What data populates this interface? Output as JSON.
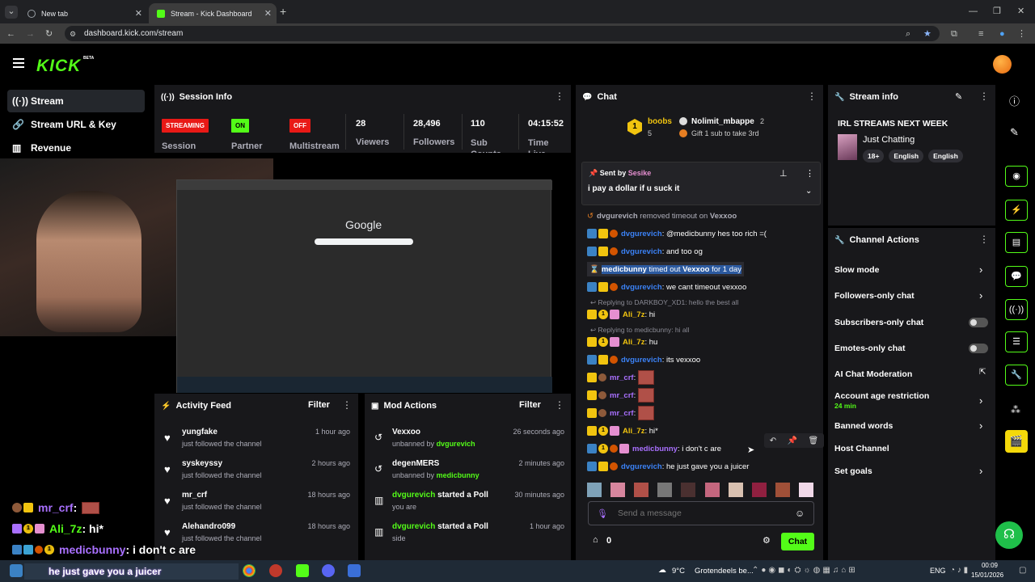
{
  "browser": {
    "tabs": [
      {
        "label": "New tab"
      },
      {
        "label": "Stream - Kick Dashboard"
      }
    ],
    "url": "dashboard.kick.com/stream"
  },
  "brand": {
    "logo": "KICK",
    "beta": "BETA"
  },
  "nav": [
    {
      "label": "Stream",
      "icon": "stream-icon"
    },
    {
      "label": "Stream URL & Key",
      "icon": "link-icon"
    },
    {
      "label": "Revenue",
      "icon": "revenue-icon"
    }
  ],
  "session": {
    "title": "Session Info",
    "streaming": "STREAMING",
    "partner_badge": "ON",
    "multistream_badge": "OFF",
    "session_label": "Session",
    "partner_label": "Partner",
    "multistream_label": "Multistream",
    "stats": [
      {
        "value": "28",
        "label": "Viewers"
      },
      {
        "value": "28,496",
        "label": "Followers"
      },
      {
        "value": "110",
        "label": "Sub Counts"
      },
      {
        "value": "04:15:52",
        "label": "Time Live"
      }
    ]
  },
  "preview": {
    "search_engine": "Google"
  },
  "activity": {
    "title": "Activity Feed",
    "filter": "Filter",
    "items": [
      {
        "name": "yungfake",
        "sub": "just followed the channel",
        "time": "1 hour ago"
      },
      {
        "name": "syskeyssy",
        "sub": "just followed the channel",
        "time": "2 hours ago"
      },
      {
        "name": "mr_crf",
        "sub": "just followed the channel",
        "time": "18 hours ago"
      },
      {
        "name": "Alehandro099",
        "sub": "just followed the channel",
        "time": "18 hours ago"
      }
    ]
  },
  "mod": {
    "title": "Mod Actions",
    "filter": "Filter",
    "items": [
      {
        "name": "Vexxoo",
        "sub_prefix": "unbanned by ",
        "sub_user": "dvgurevich",
        "time": "26 seconds ago",
        "icon": "undo-icon"
      },
      {
        "name": "degenMERS",
        "sub_prefix": "unbanned by ",
        "sub_user": "medicbunny",
        "time": "2 minutes ago",
        "icon": "undo-icon"
      },
      {
        "name": "dvgurevich",
        "name_suffix": " started a Poll",
        "sub_prefix": "you are",
        "sub_user": "",
        "time": "30 minutes ago",
        "icon": "poll-icon"
      },
      {
        "name": "dvgurevich",
        "name_suffix": " started a Poll",
        "sub_prefix": "side",
        "sub_user": "",
        "time": "1 hour ago",
        "icon": "poll-icon"
      }
    ]
  },
  "chat": {
    "title": "Chat",
    "leaderboard": {
      "rank": "1",
      "name1": "boobs",
      "count1": "5",
      "name2": "Nolimit_mbappe",
      "count2": "2",
      "gift": "Gift 1 sub to take 3rd"
    },
    "pinned": {
      "sent_by_label": "Sent by",
      "sent_by": "Sesike",
      "message": "i pay a dollar if u suck it"
    },
    "system": {
      "user": "dvgurevich",
      "text": "removed timeout on",
      "target": "Vexxoo"
    },
    "timeout": {
      "user": "medicbunny",
      "text": "timed out",
      "target": "Vexxoo",
      "duration": "for 1 day"
    },
    "messages": [
      {
        "user": "dvgurevich",
        "text": ": @medicbunny hes too rich =("
      },
      {
        "user": "dvgurevich",
        "text": ": and too og"
      },
      {
        "user": "dvgurevich",
        "text": ": we cant timeout vexxoo"
      },
      {
        "reply": "Replying to DARKBOY_XD1: hello the best all",
        "user": "Ali_7z",
        "text": ": hi"
      },
      {
        "reply": "Replying to medicbunny: hi all",
        "user": "Ali_7z",
        "text": ": hu"
      },
      {
        "user": "dvgurevich",
        "text": ": its vexxoo"
      },
      {
        "user": "mr_crf",
        "text": ":"
      },
      {
        "user": "mr_crf",
        "text": ":"
      },
      {
        "user": "mr_crf",
        "text": ":"
      },
      {
        "user": "Ali_7z",
        "text": ": hi*"
      },
      {
        "user": "medicbunny",
        "text": ": i don't c are"
      },
      {
        "user": "dvgurevich",
        "text": ": he just gave you a juicer"
      }
    ],
    "input_placeholder": "Send a message",
    "points": "0",
    "send": "Chat"
  },
  "stream_info": {
    "title": "Stream info",
    "stream_title": "IRL STREAMS NEXT WEEK",
    "category": "Just Chatting",
    "tags": [
      "18+",
      "English",
      "English"
    ]
  },
  "channel_actions": {
    "title": "Channel Actions",
    "items": [
      {
        "label": "Slow mode",
        "control": "chevron"
      },
      {
        "label": "Followers-only chat",
        "control": "chevron"
      },
      {
        "label": "Subscribers-only chat",
        "control": "toggle",
        "value": false
      },
      {
        "label": "Emotes-only chat",
        "control": "toggle",
        "value": false
      },
      {
        "label": "AI Chat Moderation",
        "control": "external"
      },
      {
        "label": "Account age restriction",
        "sub": "24 min",
        "control": "chevron"
      },
      {
        "label": "Banned words",
        "control": "chevron"
      },
      {
        "label": "Host Channel",
        "control": "none"
      },
      {
        "label": "Set goals",
        "control": "chevron"
      }
    ]
  },
  "overlay": [
    {
      "user": "mr_crf",
      "text": ":"
    },
    {
      "user": "Ali_7z",
      "text": ": hi*"
    },
    {
      "user": "medicbunny",
      "text": ": i don't c are"
    }
  ],
  "taskbar": {
    "ticker": "he just gave you a juicer",
    "weather_temp": "9°C",
    "weather_text": "Grotendeels be...",
    "lang": "ENG",
    "time": "00:09",
    "date": "15/01/2026"
  },
  "colors": {
    "accent": "#53fc18",
    "panel": "#18181b",
    "green_user": "#53fc18",
    "blue_user": "#3b82f6",
    "purple_user": "#a970ff",
    "streaming_red": "#e91916"
  }
}
